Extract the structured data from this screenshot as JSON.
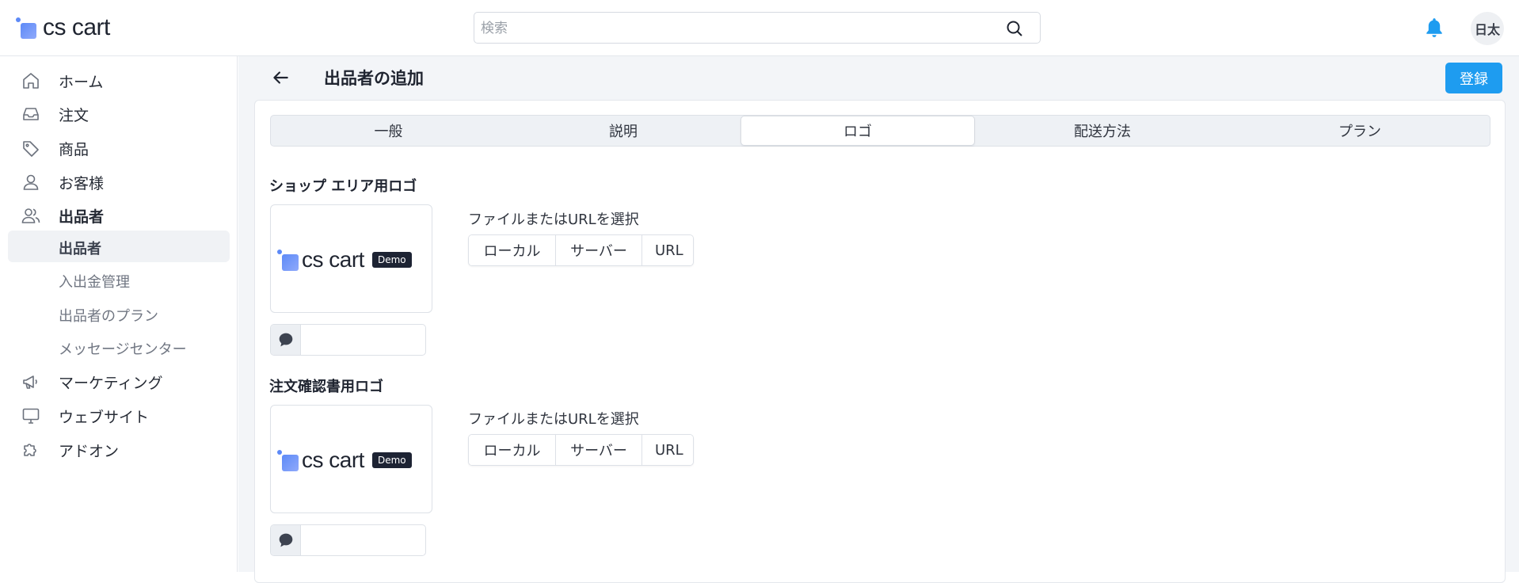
{
  "header": {
    "logo_text": "cs cart",
    "search_placeholder": "検索",
    "user_initials": "日太"
  },
  "sidebar": {
    "items": [
      {
        "label": "ホーム",
        "icon": "home-icon"
      },
      {
        "label": "注文",
        "icon": "inbox-icon"
      },
      {
        "label": "商品",
        "icon": "tag-icon"
      },
      {
        "label": "お客様",
        "icon": "user-icon"
      },
      {
        "label": "出品者",
        "icon": "users-icon"
      },
      {
        "label": "マーケティング",
        "icon": "megaphone-icon"
      },
      {
        "label": "ウェブサイト",
        "icon": "monitor-icon"
      },
      {
        "label": "アドオン",
        "icon": "puzzle-icon"
      }
    ],
    "sub_items": [
      {
        "label": "出品者"
      },
      {
        "label": "入出金管理"
      },
      {
        "label": "出品者のプラン"
      },
      {
        "label": "メッセージセンター"
      }
    ]
  },
  "page": {
    "title": "出品者の追加",
    "save_label": "登録"
  },
  "tabs": [
    {
      "label": "一般"
    },
    {
      "label": "説明"
    },
    {
      "label": "ロゴ"
    },
    {
      "label": "配送方法"
    },
    {
      "label": "プラン"
    }
  ],
  "active_tab": "ロゴ",
  "sections": [
    {
      "title": "ショップ エリア用ロゴ",
      "preview_logo_text": "cs cart",
      "preview_badge": "Demo",
      "file_label": "ファイルまたはURLを選択",
      "buttons": [
        "ローカル",
        "サーバー",
        "URL"
      ],
      "alt_text_value": ""
    },
    {
      "title": "注文確認書用ロゴ",
      "preview_logo_text": "cs cart",
      "preview_badge": "Demo",
      "file_label": "ファイルまたはURLを選択",
      "buttons": [
        "ローカル",
        "サーバー",
        "URL"
      ],
      "alt_text_value": ""
    }
  ],
  "colors": {
    "accent": "#1e9cf0",
    "logo_gradient_start": "#5d8af7",
    "logo_gradient_end": "#8fa9fb",
    "demo_badge": "#1d2333",
    "page_background": "#f3f5f8"
  }
}
